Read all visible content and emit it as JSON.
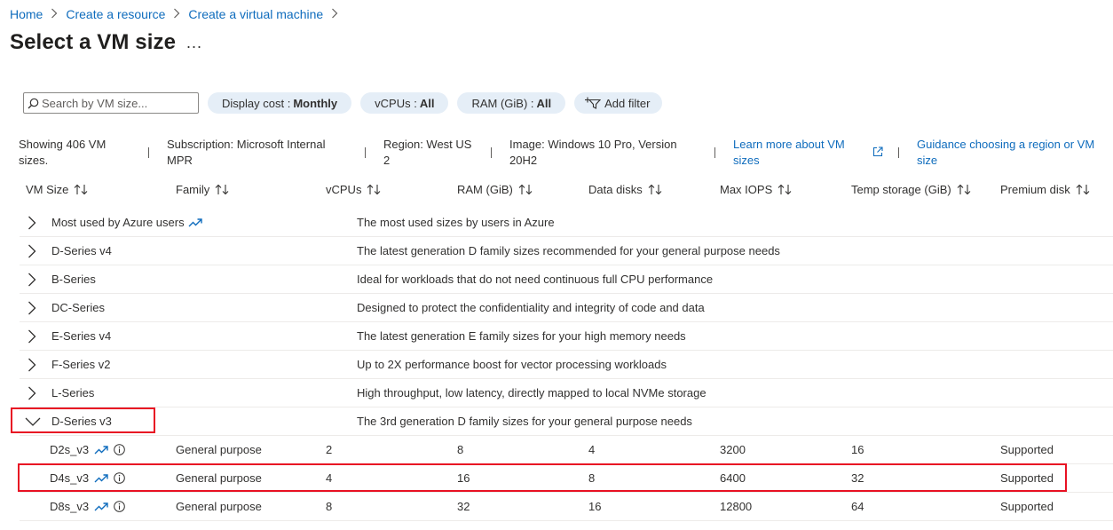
{
  "breadcrumb": {
    "items": [
      {
        "label": "Home"
      },
      {
        "label": "Create a resource"
      },
      {
        "label": "Create a virtual machine"
      }
    ]
  },
  "page": {
    "title": "Select a VM size",
    "more_label": "..."
  },
  "toolbar": {
    "search_placeholder": "Search by VM size...",
    "filters": [
      {
        "label": "Display cost :",
        "value": "Monthly"
      },
      {
        "label": "vCPUs :",
        "value": "All"
      },
      {
        "label": "RAM (GiB) :",
        "value": "All"
      }
    ],
    "add_filter_label": "Add filter"
  },
  "info": {
    "showing": "Showing 406 VM sizes.",
    "subscription": "Subscription: Microsoft Internal MPR",
    "region": "Region: West US 2",
    "image": "Image: Windows 10 Pro, Version 20H2",
    "learn_more": "Learn more about VM sizes",
    "guidance": "Guidance choosing a region or VM size"
  },
  "table": {
    "columns": [
      "VM Size",
      "Family",
      "vCPUs",
      "RAM (GiB)",
      "Data disks",
      "Max IOPS",
      "Temp storage (GiB)",
      "Premium disk"
    ],
    "groups": [
      {
        "name": "Most used by Azure users",
        "description": "The most used sizes by users in Azure",
        "trend": true,
        "expanded": false
      },
      {
        "name": "D-Series v4",
        "description": "The latest generation D family sizes recommended for your general purpose needs",
        "expanded": false
      },
      {
        "name": "B-Series",
        "description": "Ideal for workloads that do not need continuous full CPU performance",
        "expanded": false
      },
      {
        "name": "DC-Series",
        "description": "Designed to protect the confidentiality and integrity of code and data",
        "expanded": false
      },
      {
        "name": "E-Series v4",
        "description": "The latest generation E family sizes for your high memory needs",
        "expanded": false
      },
      {
        "name": "F-Series v2",
        "description": "Up to 2X performance boost for vector processing workloads",
        "expanded": false
      },
      {
        "name": "L-Series",
        "description": "High throughput, low latency, directly mapped to local NVMe storage",
        "expanded": false
      },
      {
        "name": "D-Series v3",
        "description": "The 3rd generation D family sizes for your general purpose needs",
        "expanded": true
      }
    ],
    "rows": [
      {
        "size": "D2s_v3",
        "family": "General purpose",
        "vcpus": "2",
        "ram": "8",
        "data_disks": "4",
        "max_iops": "3200",
        "temp_storage": "16",
        "premium_disk": "Supported"
      },
      {
        "size": "D4s_v3",
        "family": "General purpose",
        "vcpus": "4",
        "ram": "16",
        "data_disks": "8",
        "max_iops": "6400",
        "temp_storage": "32",
        "premium_disk": "Supported"
      },
      {
        "size": "D8s_v3",
        "family": "General purpose",
        "vcpus": "8",
        "ram": "32",
        "data_disks": "16",
        "max_iops": "12800",
        "temp_storage": "64",
        "premium_disk": "Supported"
      }
    ]
  },
  "colors": {
    "link": "#0f6cbd",
    "pill_background": "#e5eef7",
    "highlight": "#e81123"
  }
}
